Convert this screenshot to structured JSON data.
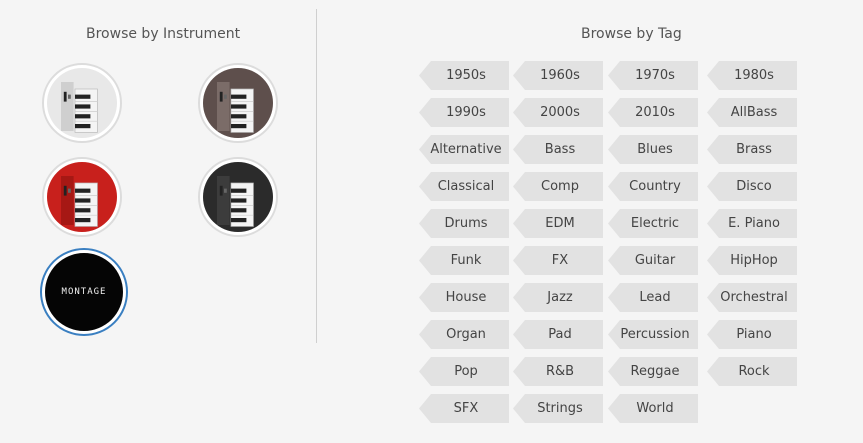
{
  "instrument_section": {
    "title": "Browse by Instrument",
    "instruments": [
      {
        "name": "instrument-white-keyboard",
        "color": "#e8e8e8",
        "panel": "#cfcfcf",
        "selected": false
      },
      {
        "name": "instrument-mocha-keyboard",
        "color": "#5e4f4c",
        "panel": "#7b6c68",
        "selected": false
      },
      {
        "name": "instrument-red-keyboard",
        "color": "#c8201c",
        "panel": "#a61814",
        "selected": false
      },
      {
        "name": "instrument-black-keyboard",
        "color": "#2b2b2b",
        "panel": "#3c3c3c",
        "selected": false
      },
      {
        "name": "instrument-montage",
        "color": "#050505",
        "logo": "MONTAGE",
        "selected": true
      }
    ]
  },
  "tag_section": {
    "title": "Browse by Tag",
    "tags": [
      "1950s",
      "1960s",
      "1970s",
      "1980s",
      "1990s",
      "2000s",
      "2010s",
      "AllBass",
      "Alternative",
      "Bass",
      "Blues",
      "Brass",
      "Classical",
      "Comp",
      "Country",
      "Disco",
      "Drums",
      "EDM",
      "Electric",
      "E. Piano",
      "Funk",
      "FX",
      "Guitar",
      "HipHop",
      "House",
      "Jazz",
      "Lead",
      "Orchestral",
      "Organ",
      "Pad",
      "Percussion",
      "Piano",
      "Pop",
      "R&B",
      "Reggae",
      "Rock",
      "SFX",
      "Strings",
      "World"
    ]
  },
  "colors": {
    "tag_background": "#e2e2e2",
    "selected_border": "#3a7fc1",
    "circle_border": "#dcdcdc"
  }
}
